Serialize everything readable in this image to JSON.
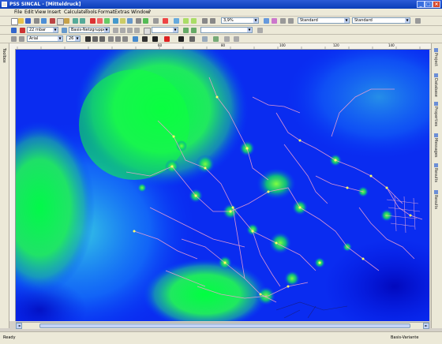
{
  "window": {
    "title": "PSS SINCAL - [Mitteldruck]"
  },
  "menu": {
    "items": [
      "File",
      "Edit",
      "View",
      "Insert",
      "Calculate",
      "Tools",
      "Format",
      "Extras",
      "Window",
      "?"
    ]
  },
  "toolbar": {
    "zoom_value": "3,9%",
    "style_combo_1": "Standard",
    "style_combo_2": "Standard",
    "pressure_combo": "22 mbar",
    "group_combo": "Basis-Netzgruppe",
    "font_combo": "Arial",
    "font_size_combo": "26"
  },
  "left_panel": {
    "tabs": [
      "Toolbox"
    ]
  },
  "right_panel": {
    "tabs": [
      "Project",
      "Database",
      "Properties",
      "Messages",
      "Results",
      "Results"
    ]
  },
  "ruler": {
    "labels": [
      "60",
      "80",
      "100",
      "120",
      "140"
    ]
  },
  "status": {
    "left": "Ready",
    "variant": "Basis-Variante"
  },
  "colors": {
    "network_line": "#f2a6c8",
    "node": "#ffff66",
    "hot": "#00ff80",
    "bg": "#0010e0"
  }
}
